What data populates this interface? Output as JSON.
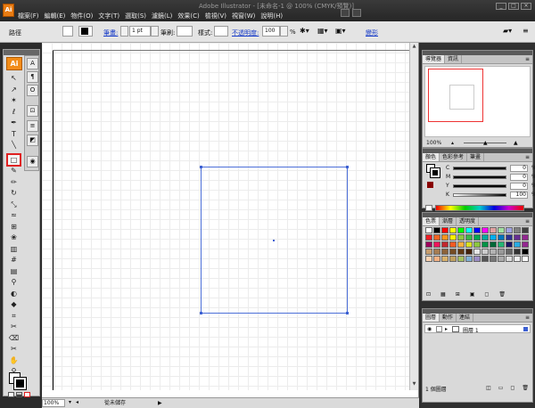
{
  "window": {
    "title": "Adobe Illustrator - [未命名-1 @ 100% (CMYK/預覽)]",
    "logo_text": "Ai"
  },
  "menu": [
    "檔案(F)",
    "編輯(E)",
    "物件(O)",
    "文字(T)",
    "選取(S)",
    "濾鏡(L)",
    "效果(C)",
    "檢視(V)",
    "視窗(W)",
    "說明(H)"
  ],
  "window_controls": {
    "minimize": "_",
    "restore": "□",
    "close": "×"
  },
  "controlbar": {
    "selection_label": "路徑",
    "stroke_label": "筆畫:",
    "stroke_weight": "1 pt",
    "brush_label": "筆刷:",
    "style_label": "樣式:",
    "opacity_label": "不透明度:",
    "opacity_value": "100",
    "opacity_unit": "%",
    "transform_label": "變形"
  },
  "tools": {
    "badge": "Ai",
    "items": [
      {
        "name": "selection-tool",
        "glyph": "↖"
      },
      {
        "name": "direct-selection-tool",
        "glyph": "↗"
      },
      {
        "name": "magic-wand-tool",
        "glyph": "✶"
      },
      {
        "name": "lasso-tool",
        "glyph": "ℓ"
      },
      {
        "name": "pen-tool",
        "glyph": "✒"
      },
      {
        "name": "type-tool",
        "glyph": "T"
      },
      {
        "name": "line-tool",
        "glyph": "╲"
      },
      {
        "name": "rectangle-tool",
        "glyph": "□"
      },
      {
        "name": "paintbrush-tool",
        "glyph": "✎"
      },
      {
        "name": "pencil-tool",
        "glyph": "✏"
      },
      {
        "name": "rotate-tool",
        "glyph": "↻"
      },
      {
        "name": "scale-tool",
        "glyph": "⤡"
      },
      {
        "name": "warp-tool",
        "glyph": "≈"
      },
      {
        "name": "free-transform-tool",
        "glyph": "⊞"
      },
      {
        "name": "symbol-sprayer-tool",
        "glyph": "❀"
      },
      {
        "name": "graph-tool",
        "glyph": "▥"
      },
      {
        "name": "mesh-tool",
        "glyph": "#"
      },
      {
        "name": "gradient-tool",
        "glyph": "▤"
      },
      {
        "name": "eyedropper-tool",
        "glyph": "⚲"
      },
      {
        "name": "blend-tool",
        "glyph": "◐"
      },
      {
        "name": "live-paint-tool",
        "glyph": "◆"
      },
      {
        "name": "crop-tool",
        "glyph": "⌗"
      },
      {
        "name": "slice-tool",
        "glyph": "✂"
      },
      {
        "name": "eraser-tool",
        "glyph": "⌫"
      },
      {
        "name": "scissors-tool",
        "glyph": "✂"
      },
      {
        "name": "hand-tool",
        "glyph": "✋"
      },
      {
        "name": "zoom-tool",
        "glyph": "⚲"
      }
    ]
  },
  "dock2": [
    {
      "name": "character-panel-icon",
      "glyph": "A"
    },
    {
      "name": "paragraph-panel-icon",
      "glyph": "¶"
    },
    {
      "name": "opentype-panel-icon",
      "glyph": "O"
    },
    {
      "name": "transform-panel-icon",
      "glyph": "⊡"
    },
    {
      "name": "align-panel-icon",
      "glyph": "≡"
    },
    {
      "name": "pathfinder-panel-icon",
      "glyph": "◩"
    },
    {
      "name": "appearance-panel-icon",
      "glyph": "◉"
    }
  ],
  "status": {
    "zoom": "100%",
    "text": "從未儲存",
    "arrow": "▶"
  },
  "navigator": {
    "tabs": [
      "導覽器",
      "資訊"
    ],
    "zoom": "100%"
  },
  "color_panel": {
    "tabs": [
      "顏色",
      "色彩參考",
      "筆畫"
    ],
    "channels": [
      {
        "label": "C",
        "value": "0"
      },
      {
        "label": "M",
        "value": "0"
      },
      {
        "label": "Y",
        "value": "0"
      },
      {
        "label": "K",
        "value": "100"
      }
    ],
    "unit": "%"
  },
  "swatches_panel": {
    "tabs": [
      "色票",
      "漸層",
      "透明度"
    ],
    "colors": [
      "#ffffff",
      "#000000",
      "#ff0000",
      "#ffff00",
      "#00ff00",
      "#00ffff",
      "#0000ff",
      "#ff00ff",
      "#e0a0a0",
      "#a0e0a0",
      "#a0a0e0",
      "#808080",
      "#404040",
      "#ee1c24",
      "#f26522",
      "#f7941d",
      "#fff200",
      "#8dc63f",
      "#39b54a",
      "#00a651",
      "#00a99d",
      "#00aeef",
      "#0072bc",
      "#2e3192",
      "#662d91",
      "#92278f",
      "#9e005d",
      "#ed145b",
      "#c1272d",
      "#f15a24",
      "#fbb03b",
      "#d9e021",
      "#8cc63f",
      "#009245",
      "#006837",
      "#22b573",
      "#1b1464",
      "#29abe2",
      "#93278f",
      "#c69c6d",
      "#a67c52",
      "#8c6239",
      "#754c24",
      "#603813",
      "#42210b",
      "#e6e6e6",
      "#cccccc",
      "#b3b3b3",
      "#999999",
      "#666666",
      "#333333",
      "#000000",
      "#fcd2b0",
      "#f4b183",
      "#d8b06a",
      "#c0a060",
      "#a4c060",
      "#7fb1d6",
      "#9a8bc4",
      "#555555",
      "#777777",
      "#aaaaaa",
      "#dddddd",
      "#f0f0f0",
      "#ffffff"
    ]
  },
  "layers_panel": {
    "tabs": [
      "圖層",
      "動作",
      "連結"
    ],
    "layer_name": "圖層 1",
    "count": "1 個圖層"
  }
}
